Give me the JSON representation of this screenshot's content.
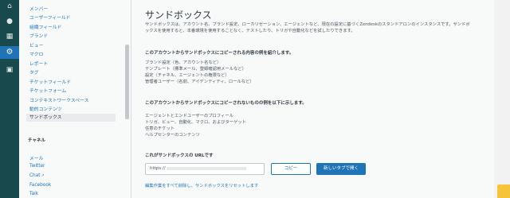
{
  "rail": {
    "icons": [
      "home-icon",
      "users-icon",
      "building-icon",
      "reports-icon",
      "gear-icon",
      "apps-icon"
    ]
  },
  "nav": {
    "items": [
      "メンバー",
      "ユーザーフィールド",
      "組織フィールド",
      "ブランド",
      "ビュー",
      "マクロ",
      "レポート",
      "タグ",
      "チケットフィールド",
      "チケットフォーム",
      "コンテキストワークスペース",
      "動的コンテンツ",
      "サンドボックス"
    ],
    "channel_heading": "チャネル",
    "channels": [
      "メール",
      "Twitter",
      "Chat",
      "Facebook",
      "Talk"
    ]
  },
  "main": {
    "title": "サンドボックス",
    "description": "サンドボックスは、アカウント名、ブランド設定、ローカリゼーション、エージェントなど、現在の設定に基づくZendeskのスタンドアロンのインスタンスです。サンドボックスを使用すると、本番環境を使用することなく、テストしたり、トリガや自動化などを試したりできます。",
    "copied_heading": "このアカウントからサンドボックスにコピーされる内容の例を紹介します。",
    "copied_items": [
      "ブランド設定（色、アカウント名など）",
      "テンプレート（標準メール、登録確認用メールなど）",
      "設定（チャネル、エージェントの権限など）",
      "管理者ユーザー（名前、アイデンティティ、ロールなど）"
    ],
    "not_copied_heading": "このアカウントからサンドボックスにコピーされないものの例を以下に示します。",
    "not_copied_items": [
      "エージェントとエンドユーザーのプロフィール",
      "トリガ、ビュー、自動化、マクロ、およびターゲット",
      "任意のチケット",
      "ヘルプセンターのコンテンツ"
    ],
    "url_label": "これがサンドボックスの URLです",
    "url_value": "https://",
    "copy_button": "コピー",
    "open_button": "新しいタブで開く",
    "reset_link": "編集作業をすべて削除し、サンドボックスをリセットします"
  }
}
